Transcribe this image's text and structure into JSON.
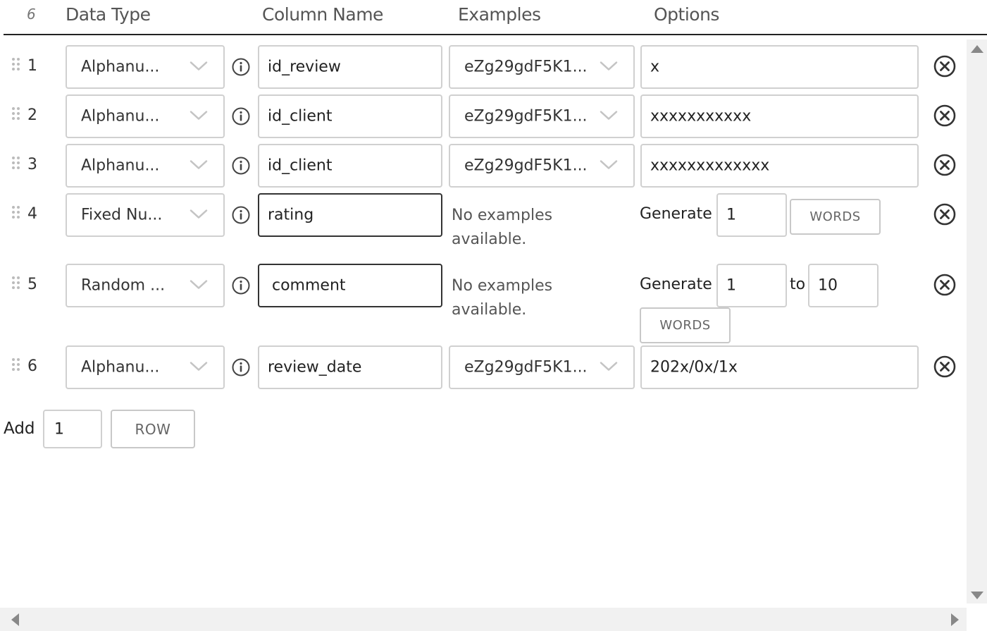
{
  "header": {
    "row_count": "6",
    "col_data_type": "Data Type",
    "col_column_name": "Column Name",
    "col_examples": "Examples",
    "col_options": "Options"
  },
  "rows": [
    {
      "num": "1",
      "data_type": "Alphanu...",
      "column_name": "id_review",
      "example": "eZg29gdF5K1...",
      "option": "x"
    },
    {
      "num": "2",
      "data_type": "Alphanu...",
      "column_name": "id_client",
      "example": "eZg29gdF5K1...",
      "option": "xxxxxxxxxxx"
    },
    {
      "num": "3",
      "data_type": "Alphanu...",
      "column_name": "id_client",
      "example": "eZg29gdF5K1...",
      "option": "xxxxxxxxxxxxx"
    },
    {
      "num": "4",
      "data_type": "Fixed Nu...",
      "column_name": "rating",
      "example_none": "No examples available.",
      "example_line1": "No examples",
      "example_line2": "available.",
      "generate_label": "Generate",
      "count": "1",
      "unit_button": "WORDS"
    },
    {
      "num": "5",
      "data_type": "Random ...",
      "column_name": "comment",
      "example_line1": "No examples",
      "example_line2": "available.",
      "generate_label": "Generate",
      "min": "1",
      "to_label": "to",
      "max": "10",
      "unit_button": "WORDS"
    },
    {
      "num": "6",
      "data_type": "Alphanu...",
      "column_name": "review_date",
      "example": "eZg29gdF5K1...",
      "option": "202x/0x/1x"
    }
  ],
  "footer": {
    "add_label": "Add",
    "add_count": "1",
    "add_button": "ROW"
  },
  "icons": {
    "info": "info-icon",
    "remove": "remove-circle-x-icon",
    "drag": "drag-handle-icon",
    "chevron": "chevron-down-icon"
  },
  "colors": {
    "border_light": "#d0d0d0",
    "border_focus": "#333333",
    "text_muted": "#555555",
    "scrollbar_track": "#f1f1f1"
  }
}
